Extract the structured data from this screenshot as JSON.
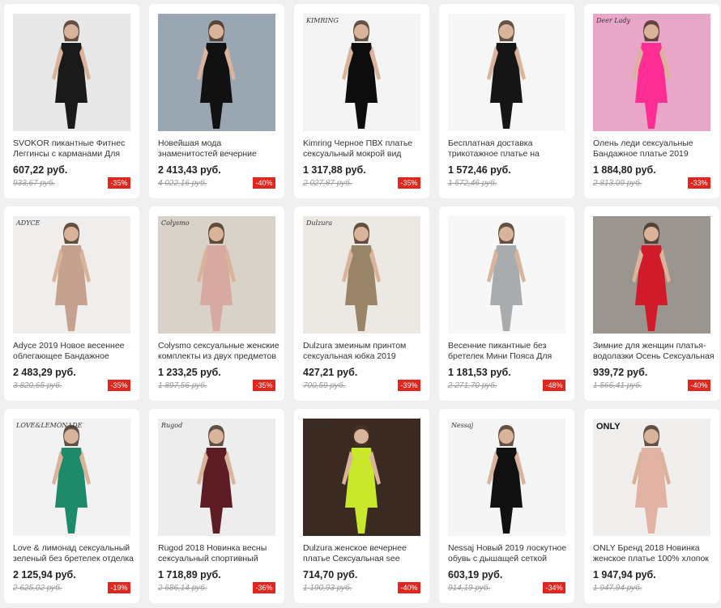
{
  "products": [
    {
      "title": "SVOKOR пикантные Фитнес Леггинсы с карманами Для",
      "price": "607,22 руб.",
      "old_price": "933,67 руб.",
      "discount": "-35%",
      "bg": "#e8e8e8",
      "figure": "#1a1a1a",
      "image": "leggings-photo"
    },
    {
      "title": "Новейшая мода знаменитостей вечерние",
      "price": "2 413,43 руб.",
      "old_price": "4 022,16 руб.",
      "discount": "-40%",
      "bg": "#9aa6b2",
      "figure": "#111111",
      "image": "black-fringe-dress-photo"
    },
    {
      "title": "Kimring Черное ПВХ платье сексуальный мокрой вид",
      "price": "1 317,88 руб.",
      "old_price": "2 027,87 руб.",
      "discount": "-35%",
      "bg": "#f4f4f4",
      "figure": "#0d0d0d",
      "image": "black-pvc-dress-photo",
      "brand": "KIMRING"
    },
    {
      "title": "Бесплатная доставка трикотажное платье на",
      "price": "1 572,46 руб.",
      "old_price": "1 572,46 руб.",
      "discount": "",
      "bg": "#f6f6f6",
      "figure": "#151515",
      "image": "black-knit-dress-photo"
    },
    {
      "title": "Олень леди сексуальные Бандажное платье 2019 Новые",
      "price": "1 884,80 руб.",
      "old_price": "2 813,09 руб.",
      "discount": "-33%",
      "bg": "#e8a7c8",
      "figure": "#ff2d94",
      "image": "pink-bandage-dress-photo",
      "brand": "Deer Lady"
    },
    {
      "title": "Adyce 2019 Новое весеннее облегающее Бандажное",
      "price": "2 483,29 руб.",
      "old_price": "3 820,65 руб.",
      "discount": "-35%",
      "bg": "#f0eeec",
      "figure": "#c7a190",
      "image": "nude-bandage-dress-photo",
      "brand": "ADYCE"
    },
    {
      "title": "Colysmo сексуальные женские комплекты из двух предметов",
      "price": "1 233,25 руб.",
      "old_price": "1 897,56 руб.",
      "discount": "-35%",
      "bg": "#d9d2c8",
      "figure": "#d8a9a0",
      "image": "pink-two-piece-photo",
      "brand": "Colysmo"
    },
    {
      "title": "Dulzura змеиным принтом сексуальная юбка 2019",
      "price": "427,21 руб.",
      "old_price": "700,59 руб.",
      "discount": "-39%",
      "bg": "#ece9e4",
      "figure": "#9a8467",
      "image": "snake-print-skirt-photo",
      "brand": "Dulzura"
    },
    {
      "title": "Весенние пикантные без бретелек Мини Пояса Для",
      "price": "1 181,53 руб.",
      "old_price": "2 271,70 руб.",
      "discount": "-48%",
      "bg": "#f7f7f7",
      "figure": "#a9acaf",
      "image": "grey-mini-dress-photo"
    },
    {
      "title": "Зимние для женщин платья-водолазки Осень Сексуальная",
      "price": "939,72 руб.",
      "old_price": "1 566,41 руб.",
      "discount": "-40%",
      "bg": "#9b9590",
      "figure": "#d11a2a",
      "image": "red-turtleneck-dress-photo"
    },
    {
      "title": "Love & лимонад сексуальный зеленый без бретелек отделка",
      "price": "2 125,94 руб.",
      "old_price": "2 625,02 руб.",
      "discount": "-19%",
      "bg": "#f2f2f2",
      "figure": "#1f8a6a",
      "image": "green-sequin-dress-photo",
      "brand": "LOVE&LEMONADE"
    },
    {
      "title": "Rugod 2018 Новинка весны сексуальный спортивный",
      "price": "1 718,89 руб.",
      "old_price": "2 686,14 руб.",
      "discount": "-36%",
      "bg": "#ededed",
      "figure": "#5e1d24",
      "image": "burgundy-tracksuit-photo",
      "brand": "Rugod"
    },
    {
      "title": "Dulzura женское вечернее платье Сексуальная see",
      "price": "714,70 руб.",
      "old_price": "1 190,93 руб.",
      "discount": "-40%",
      "bg": "#3a2a22",
      "figure": "#c9e82c",
      "image": "neon-mesh-dress-photo",
      "brand": "Dulzura"
    },
    {
      "title": "Nessaj Новый 2019 лоскутное обувь с дышащей сеткой",
      "price": "603,19 руб.",
      "old_price": "914,19 руб.",
      "discount": "-34%",
      "bg": "#f5f5f5",
      "figure": "#111111",
      "image": "mesh-leggings-photo",
      "brand": "Nessaj"
    },
    {
      "title": "ONLY Бренд 2018 Новинка женское платье 100% хлопок",
      "price": "1 947,94 руб.",
      "old_price": "1 947,94 руб.",
      "discount": "",
      "bg": "#f1efed",
      "figure": "#e2b2a4",
      "image": "pink-lace-dress-photo",
      "brand": "ONLY"
    }
  ]
}
